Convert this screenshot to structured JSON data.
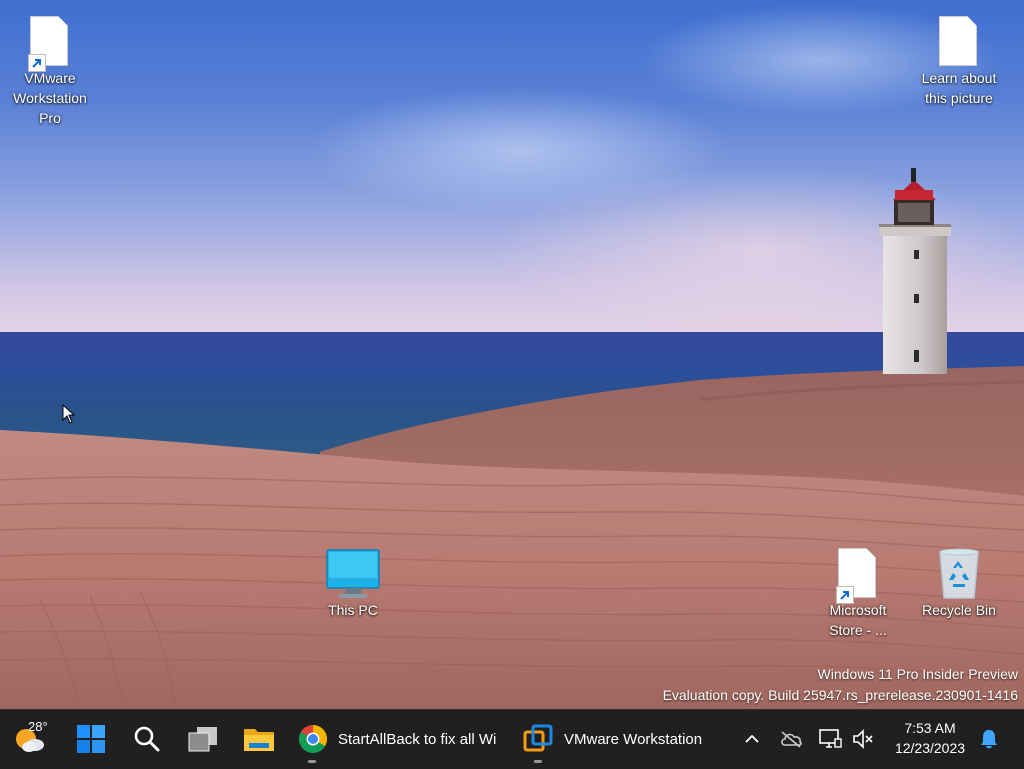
{
  "desktop": {
    "icons": [
      {
        "label": "VMware Workstation Pro",
        "icon": "vmware-shortcut-icon"
      },
      {
        "label": "Learn about this picture",
        "icon": "document-icon"
      },
      {
        "label": "This PC",
        "icon": "monitor-icon"
      },
      {
        "label": "Microsoft Store - ...",
        "icon": "store-shortcut-icon"
      },
      {
        "label": "Recycle Bin",
        "icon": "recycle-bin-icon"
      }
    ],
    "watermark": {
      "line1": "Windows 11 Pro Insider Preview",
      "line2": "Evaluation copy. Build 25947.rs_prerelease.230901-1416"
    }
  },
  "taskbar": {
    "weather": {
      "temp": "28°",
      "icon": "weather-partly-cloudy-icon"
    },
    "start_icon": "windows-logo-icon",
    "search_icon": "search-icon",
    "task_view_icon": "task-view-icon",
    "file_explorer_icon": "folder-icon",
    "apps": [
      {
        "label": "StartAllBack to fix all Wi",
        "icon": "chrome-icon"
      },
      {
        "label": "VMware Workstation",
        "icon": "vmware-icon"
      }
    ],
    "tray": {
      "overflow_icon": "chevron-up-icon",
      "onedrive_icon": "cloud-offline-icon",
      "network_icon": "network-icon",
      "volume_icon": "volume-muted-icon",
      "notification_icon": "bell-icon"
    },
    "clock": {
      "time": "7:53 AM",
      "date": "12/23/2023"
    }
  },
  "colors": {
    "taskbar": "#202020",
    "accent": "#0078d4",
    "notification_bell": "#3ea6ff"
  }
}
